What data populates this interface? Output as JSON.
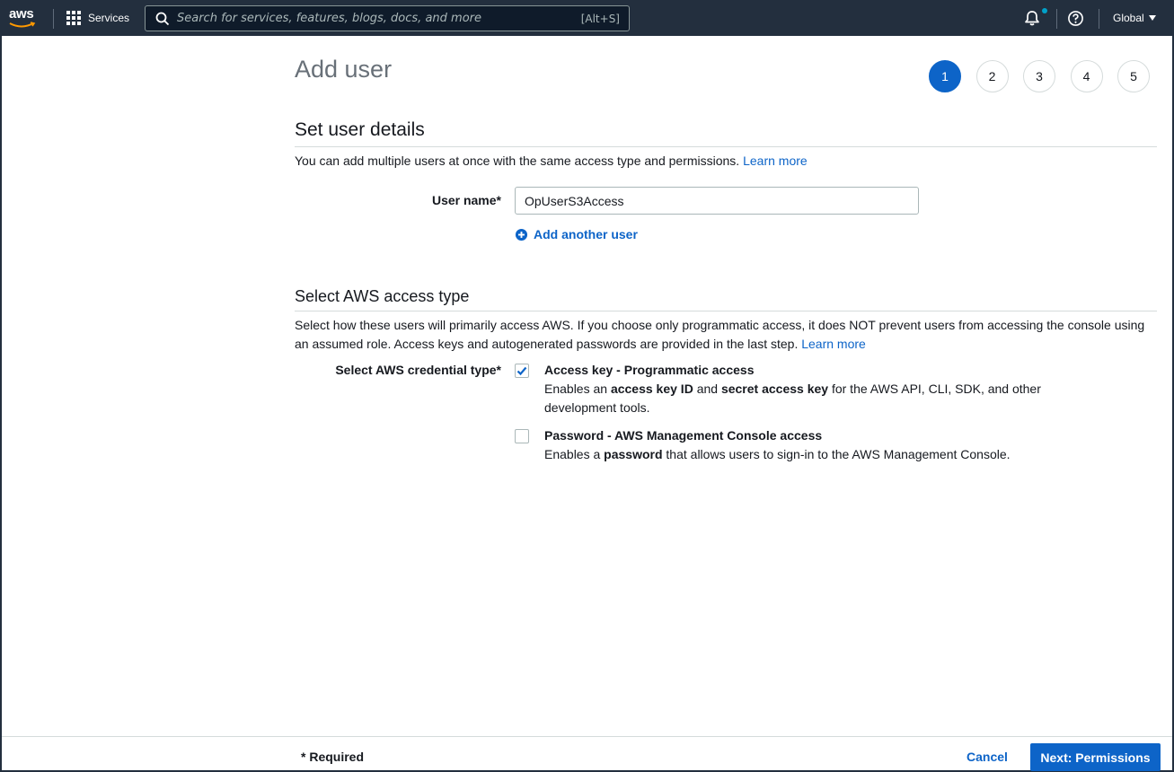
{
  "topnav": {
    "logo_text": "aws",
    "services_label": "Services",
    "search_placeholder": "Search for services, features, blogs, docs, and more",
    "search_shortcut": "[Alt+S]",
    "region_label": "Global"
  },
  "page": {
    "title": "Add user",
    "steps": [
      "1",
      "2",
      "3",
      "4",
      "5"
    ],
    "active_step": "1"
  },
  "user_details": {
    "title": "Set user details",
    "description": "You can add multiple users at once with the same access type and permissions.",
    "learn_more": "Learn more",
    "user_name_label": "User name*",
    "user_name_value": "OpUserS3Access",
    "add_another_user": "Add another user"
  },
  "access_type": {
    "title": "Select AWS access type",
    "description_line1": "Select how these users will primarily access AWS. If you choose only programmatic access, it does NOT prevent users from accessing the console using",
    "description_line2": "an assumed role. Access keys and autogenerated passwords are provided in the last step.",
    "learn_more": "Learn more",
    "credential_label": "Select AWS credential type*",
    "options": [
      {
        "title": "Access key - Programmatic access",
        "checked": true,
        "desc_parts": [
          "Enables an ",
          "access key ID",
          " and ",
          "secret access key",
          " for the AWS API, CLI, SDK, and other",
          "development tools."
        ]
      },
      {
        "title": "Password - AWS Management Console access",
        "checked": false,
        "desc_parts": [
          "Enables a ",
          "password",
          " that allows users to sign-in to the AWS Management Console."
        ]
      }
    ]
  },
  "footer": {
    "required": "* Required",
    "cancel": "Cancel",
    "next": "Next: Permissions"
  },
  "colors": {
    "nav_bg": "#232f3e",
    "primary": "#0d64c8"
  }
}
